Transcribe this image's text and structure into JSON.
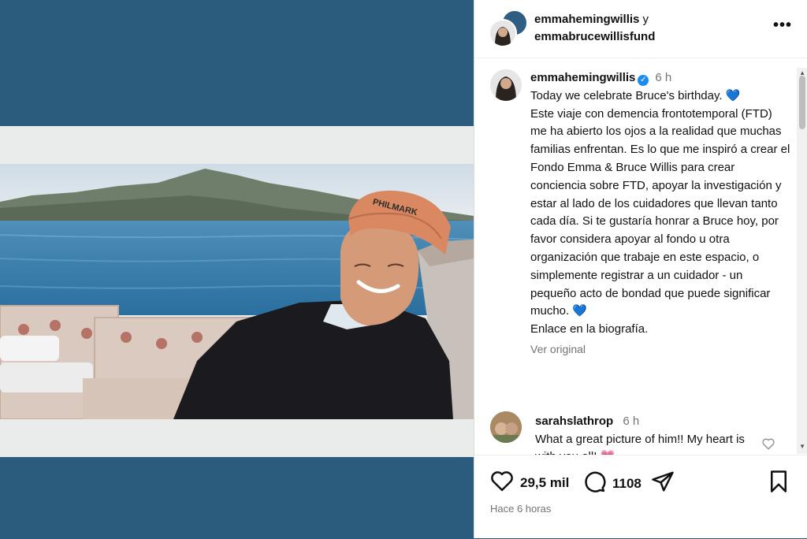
{
  "post": {
    "header": {
      "user1": "emmahemingwillis",
      "connector": "y",
      "user2": "emmabrucewillisfund"
    },
    "caption": {
      "username": "emmahemingwillis",
      "time": "6 h",
      "text": "Today we celebrate Bruce's birthday. 💙\nEste viaje con demencia frontotemporal (FTD) me ha abierto los ojos a la realidad que muchas familias enfrentan. Es lo que me inspiró a crear el Fondo Emma & Bruce Willis para crear conciencia sobre FTD, apoyar la investigación y estar al lado de los cuidadores que llevan tanto cada día. Si te gustaría honrar a Bruce hoy, por favor considera apoyar al fondo u otra organización que trabaje en este espacio, o simplemente registrar a un cuidador - un pequeño acto de bondad que puede significar mucho. 💙\nEnlace en la biografía.",
      "see_original": "Ver original"
    },
    "comment": {
      "username": "sarahslathrop",
      "time": "6 h",
      "text": "What a great picture of him!! My heart is with you all! 💗"
    },
    "actions": {
      "likes": "29,5 mil",
      "comments": "1108"
    },
    "timestamp": "Hace 6 horas",
    "photo_hat_text": "PHILMARK"
  },
  "colors": {
    "left_bg": "#2b5b7d",
    "verified": "#1d8cf0",
    "muted": "#737373"
  },
  "icons": [
    "more-icon",
    "verified-icon",
    "heart-icon",
    "comment-icon",
    "share-icon",
    "bookmark-icon"
  ]
}
